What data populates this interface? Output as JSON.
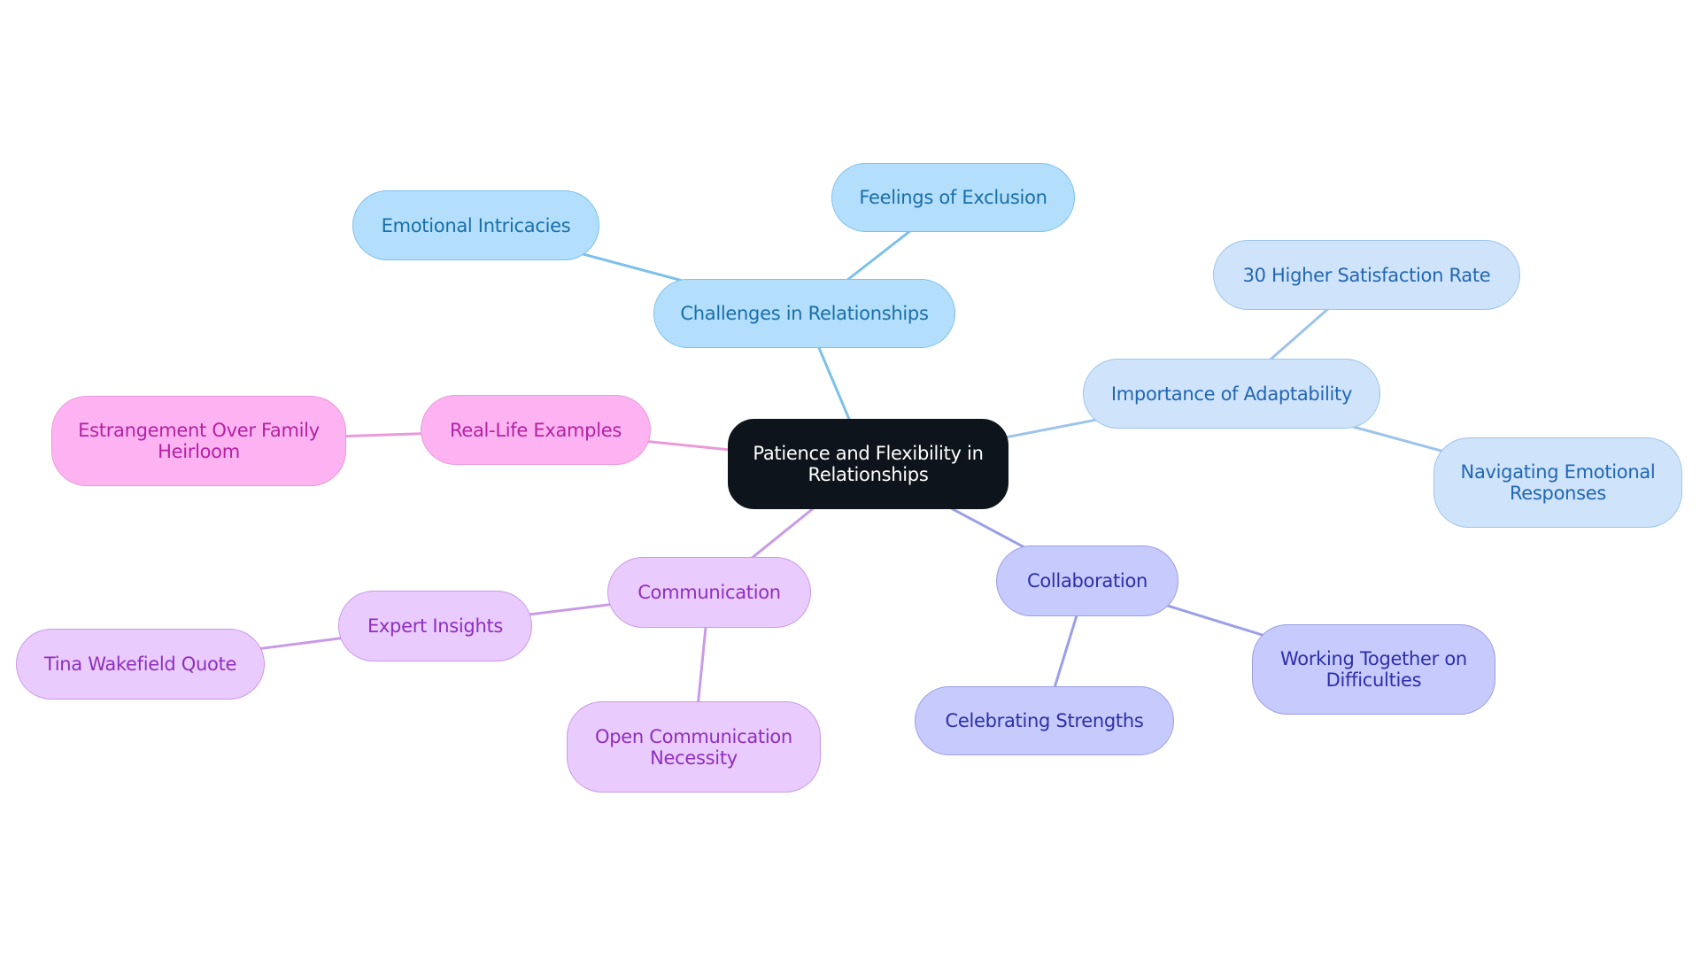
{
  "diagram": {
    "type": "mindmap",
    "root": {
      "id": "root",
      "label": "Patience and Flexibility in Relationships",
      "fill": "#0e141b",
      "text_color": "#ffffff",
      "border": "#0e141b"
    },
    "branches": [
      {
        "id": "challenges",
        "label": "Challenges in Relationships",
        "fill": "#b3dffc",
        "border": "#7cc0ea",
        "text_color": "#1a6ea8",
        "edge_color": "#7cc0ea",
        "children": [
          {
            "id": "emotional-intricacies",
            "label": "Emotional Intricacies"
          },
          {
            "id": "feelings-of-exclusion",
            "label": "Feelings of Exclusion"
          }
        ]
      },
      {
        "id": "adaptability",
        "label": "Importance of Adaptability",
        "fill": "#cfe4fb",
        "border": "#9cc4ea",
        "text_color": "#2266b3",
        "edge_color": "#9cc4ea",
        "children": [
          {
            "id": "higher-satisfaction",
            "label": "30 Higher Satisfaction Rate"
          },
          {
            "id": "navigating-emotional",
            "label": "Navigating Emotional Responses"
          }
        ]
      },
      {
        "id": "collaboration",
        "label": "Collaboration",
        "fill": "#c7cafc",
        "border": "#9a9fe6",
        "text_color": "#2d2fa8",
        "edge_color": "#9a9fe6",
        "children": [
          {
            "id": "celebrating-strengths",
            "label": "Celebrating Strengths"
          },
          {
            "id": "working-together",
            "label": "Working Together on Difficulties"
          }
        ]
      },
      {
        "id": "communication",
        "label": "Communication",
        "fill": "#eacbfd",
        "border": "#c99ae6",
        "text_color": "#8e2fbd",
        "edge_color": "#c99ae6",
        "children": [
          {
            "id": "expert-insights",
            "label": "Expert Insights",
            "children": [
              {
                "id": "tina-wakefield",
                "label": "Tina Wakefield Quote"
              }
            ]
          },
          {
            "id": "open-communication",
            "label": "Open Communication Necessity"
          }
        ]
      },
      {
        "id": "real-life",
        "label": "Real-Life Examples",
        "fill": "#fdb3f1",
        "border": "#e99ad9",
        "text_color": "#b421a3",
        "edge_color": "#e99ad9",
        "children": [
          {
            "id": "estrangement",
            "label": "Estrangement Over Family Heirloom"
          }
        ]
      }
    ]
  }
}
